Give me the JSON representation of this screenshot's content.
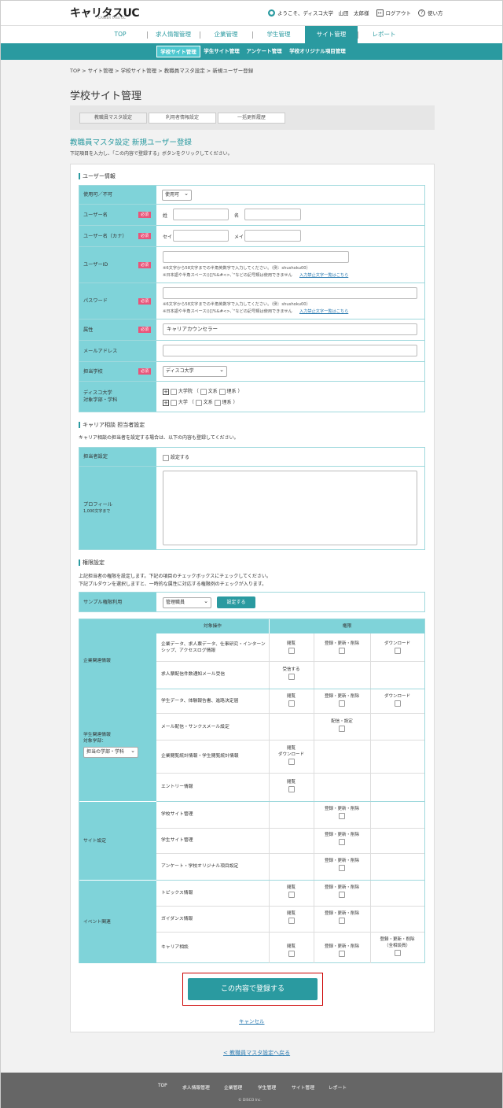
{
  "header": {
    "logo": "キャリタスUC",
    "logo_sub": "CAREER TASU UC",
    "greeting": "ようこそ、ディスコ大学　山田　太郎様",
    "logout": "ログアウト",
    "help": "使い方"
  },
  "nav": [
    "TOP",
    "求人情報管理",
    "企業管理",
    "学生管理",
    "サイト管理",
    "レポート"
  ],
  "subnav": [
    "学校サイト管理",
    "学生サイト管理",
    "アンケート管理",
    "学校オリジナル項目管理"
  ],
  "breadcrumb": "TOP > サイト管理 > 学校サイト管理 > 教職員マスタ設定 > 新規ユーザー登録",
  "page_title": "学校サイト管理",
  "tabs": [
    "教職員マスタ設定",
    "利用者情報設定",
    "一括更新履歴"
  ],
  "section_title": "教職員マスタ設定 新規ユーザー登録",
  "section_note": "下記項目を入力し、「この内容で登録する」ボタンをクリックしてください。",
  "required": "必須",
  "user": {
    "title": "ユーザー情報",
    "usage_label": "使用可／不可",
    "usage_value": "使用可",
    "name_label": "ユーザー名",
    "sei": "姓",
    "mei": "名",
    "kana_label": "ユーザー名（カナ）",
    "sei_kana": "セイ",
    "mei_kana": "メイ",
    "id_label": "ユーザーID",
    "id_note1": "※6文字から58文字までの半角英数字で入力してください。（例：shushoku00）",
    "id_note2": "※日本語や半角スペース()[]%&#<>,`\"などの記号類は使用できません",
    "forbidden_link": "入力禁止文字一覧はこちら",
    "pw_label": "パスワード",
    "pw_note1": "※6文字から58文字までの半角英数字で入力してください。（例：shushoku00）",
    "pw_note2": "※日本語や半角スペース()[]%&#<>,`\"などの記号類は使用できません",
    "attr_label": "属性",
    "attr_value": "キャリアカウンセラー",
    "mail_label": "メールアドレス",
    "school_label": "担当学校",
    "school_value": "ディスコ大学",
    "dept_label1": "ディスコ大学",
    "dept_label2": "対象学部・学科",
    "grad": "大学院",
    "univ": "大学",
    "bunkei": "文系",
    "rikei": "理系",
    "paren_open": "（",
    "paren_close": "）"
  },
  "career": {
    "title": "キャリア相談 担当者設定",
    "note": "キャリア相談の担当者を設定する場合は、以下の内容も登録してください。",
    "setting_label": "担当者設定",
    "setting_check": "設定する",
    "profile_label": "プロフィール",
    "profile_sub": "1,000文字まで"
  },
  "perm": {
    "title": "権限設定",
    "note1": "上記担当者の権限を設定します。下記の項目のチェックボックスにチェックしてください。",
    "note2": "下記プルダウンを選択しますと、一時的な属性に対応する権限例のチェックが入ります。",
    "sample_label": "サンプル権限利用",
    "sample_value": "管理職員",
    "set_button": "設定する",
    "col_target": "対象操作",
    "col_perm": "権限",
    "g_company": "企業関連情報",
    "g_student1": "学生関連情報",
    "g_student2": "対象学部：",
    "g_student_sel": "担当の学部・学科",
    "g_site": "サイト設定",
    "g_event": "イベント関連",
    "ops": [
      "企業データ、求人票データ、仕事研究・インターンシップ、アクセスログ情報",
      "求人票配信件数通知メール受信",
      "学生データ、体験報告書、進路決定届",
      "メール配信・サンクスメール設定",
      "企業閲覧統計情報・学生閲覧統計情報",
      "エントリー情報",
      "学校サイト管理",
      "学生サイト管理",
      "アンケート・学校オリジナル項目設定",
      "トピックス情報",
      "ガイダンス情報",
      "キャリア相談"
    ],
    "view": "閲覧",
    "edit": "登録・更新・削除",
    "download": "ダウンロード",
    "receive": "受信する",
    "send_set": "配信・設定",
    "edit_all": "登録・更新・削除",
    "all_school": "（全相談員）"
  },
  "register_button": "この内容で登録する",
  "cancel": "キャンセル",
  "back": "< 教職員マスタ設定へ戻る",
  "footer": {
    "items": [
      "TOP",
      "求人情報管理",
      "企業管理",
      "学生管理",
      "サイト管理",
      "レポート"
    ],
    "copyright": "© DISCO Inc."
  }
}
